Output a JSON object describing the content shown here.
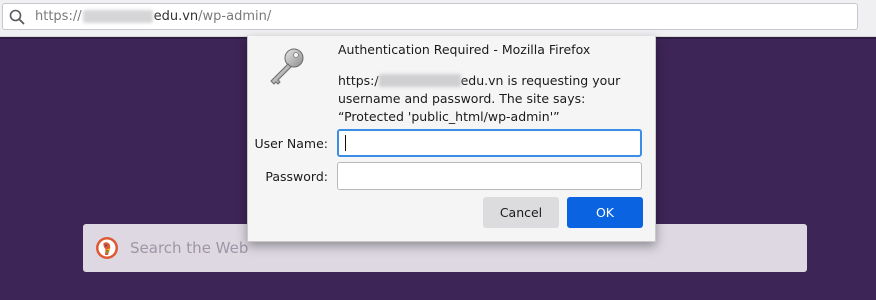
{
  "browser": {
    "url": {
      "scheme": "https://",
      "host_visible": "edu.vn",
      "path": "/wp-admin/"
    }
  },
  "new_tab_page": {
    "search_placeholder": "Search the Web",
    "search_icon": "duckduckgo-icon"
  },
  "dialog": {
    "title": "Authentication Required - Mozilla Firefox",
    "icon": "key-icon",
    "message_prefix": "https:/",
    "message_suffix": "edu.vn is requesting your username and password. The site says: “Protected 'public_html/wp-admin'”",
    "username_label": "User Name:",
    "username_value": "",
    "password_label": "Password:",
    "password_value": "",
    "cancel_label": "Cancel",
    "ok_label": "OK"
  },
  "colors": {
    "accent": "#0a63e0",
    "focus_ring": "#3a8ee6",
    "page_background": "#3d2557"
  }
}
